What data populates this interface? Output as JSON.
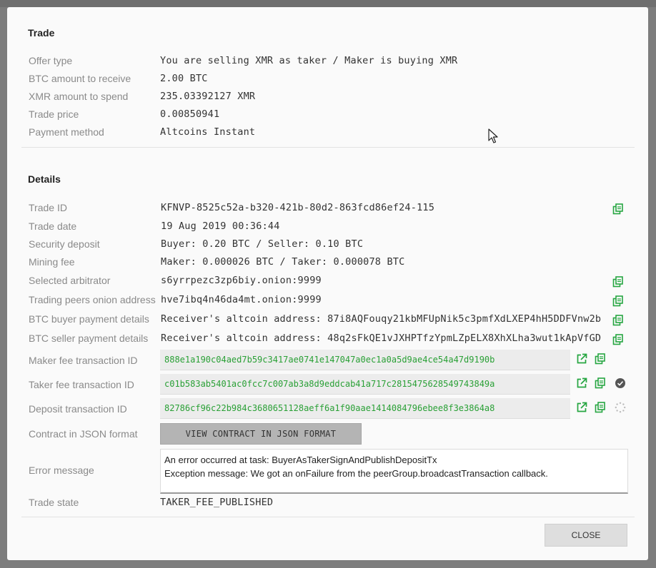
{
  "trade": {
    "title": "Trade",
    "rows": [
      {
        "label": "Offer type",
        "value": "You are selling XMR as taker / Maker is buying XMR"
      },
      {
        "label": "BTC amount to receive",
        "value": "2.00 BTC"
      },
      {
        "label": "XMR amount to spend",
        "value": "235.03392127 XMR"
      },
      {
        "label": "Trade price",
        "value": "0.00850941"
      },
      {
        "label": "Payment method",
        "value": "Altcoins Instant"
      }
    ]
  },
  "details": {
    "title": "Details",
    "trade_id": {
      "label": "Trade ID",
      "value": "KFNVP-8525c52a-b320-421b-80d2-863fcd86ef24-115"
    },
    "trade_date": {
      "label": "Trade date",
      "value": "19 Aug 2019 00:36:44"
    },
    "security_deposit": {
      "label": "Security deposit",
      "value": "Buyer: 0.20 BTC / Seller: 0.10 BTC"
    },
    "mining_fee": {
      "label": "Mining fee",
      "value": "Maker: 0.000026 BTC / Taker: 0.000078 BTC"
    },
    "arbitrator": {
      "label": "Selected arbitrator",
      "value": "s6yrrpezc3zp6biy.onion:9999"
    },
    "peer_onion": {
      "label": "Trading peers onion address",
      "value": "hve7ibq4n46da4mt.onion:9999"
    },
    "buyer_payment": {
      "label": "BTC buyer payment details",
      "value": "Receiver's altcoin address: 87i8AQFouqy21kbMFUpNik5c3pmfXdLXEP4hH5DDFVnw2b"
    },
    "seller_payment": {
      "label": "BTC seller payment details",
      "value": "Receiver's altcoin address: 48q2sFkQE1vJXHPTfzYpmLZpELX8XhXLha3wut1kApVfGD"
    },
    "maker_fee_tx": {
      "label": "Maker fee transaction ID",
      "value": "888e1a190c04aed7b59c3417ae0741e147047a0ec1a0a5d9ae4ce54a47d9190b"
    },
    "taker_fee_tx": {
      "label": "Taker fee transaction ID",
      "value": "c01b583ab5401ac0fcc7c007ab3a8d9eddcab41a717c2815475628549743849a"
    },
    "deposit_tx": {
      "label": "Deposit transaction ID",
      "value": "82786cf96c22b984c3680651128aeff6a1f90aae1414084796ebee8f3e3864a8"
    },
    "contract": {
      "label": "Contract in JSON format",
      "button": "VIEW CONTRACT IN JSON FORMAT"
    },
    "error": {
      "label": "Error message",
      "line1": "An error occurred at task: BuyerAsTakerSignAndPublishDepositTx",
      "line2": "Exception message: We got an onFailure from the peerGroup.broadcastTransaction callback."
    },
    "trade_state": {
      "label": "Trade state",
      "value": "TAKER_FEE_PUBLISHED"
    }
  },
  "footer": {
    "close_label": "CLOSE"
  },
  "colors": {
    "accent_green": "#2aa036",
    "icon_green": "#26a641"
  },
  "icons": [
    "copy-icon",
    "open-external-icon",
    "check-circle-icon",
    "spinner-icon"
  ]
}
